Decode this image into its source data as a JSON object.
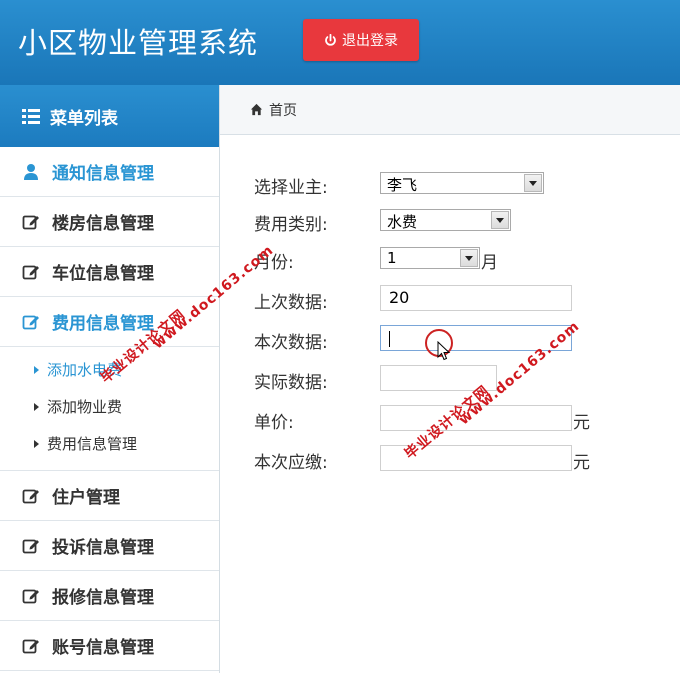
{
  "header": {
    "app_title": "小区物业管理系统",
    "logout_label": "退出登录"
  },
  "sidebar": {
    "menu_title": "菜单列表",
    "items": [
      {
        "label": "通知信息管理",
        "icon": "user-icon"
      },
      {
        "label": "楼房信息管理",
        "icon": "edit-icon"
      },
      {
        "label": "车位信息管理",
        "icon": "edit-icon"
      },
      {
        "label": "费用信息管理",
        "icon": "edit-icon"
      }
    ],
    "submenu": [
      {
        "label": "添加水电费"
      },
      {
        "label": "添加物业费"
      },
      {
        "label": "费用信息管理"
      }
    ],
    "items_after": [
      {
        "label": "住户管理",
        "icon": "edit-icon"
      },
      {
        "label": "投诉信息管理",
        "icon": "edit-icon"
      },
      {
        "label": "报修信息管理",
        "icon": "edit-icon"
      },
      {
        "label": "账号信息管理",
        "icon": "edit-icon"
      }
    ]
  },
  "breadcrumb": {
    "home_label": "首页"
  },
  "form": {
    "owner_label": "选择业主:",
    "owner_value": "李飞",
    "fee_type_label": "费用类别:",
    "fee_type_value": "水费",
    "month_label": "月份:",
    "month_value": "1",
    "month_unit": "月",
    "last_reading_label": "上次数据:",
    "last_reading_value": "20",
    "current_reading_label": "本次数据:",
    "current_reading_value": "",
    "actual_label": "实际数据:",
    "actual_value": "",
    "unit_price_label": "单价:",
    "unit_price_value": "",
    "unit_price_unit": "元",
    "amount_due_label": "本次应缴:",
    "amount_due_value": "",
    "amount_due_unit": "元"
  },
  "watermarks": [
    "毕业设计论文网",
    "www.doc163.com"
  ],
  "colors": {
    "header_blue": "#1f80c4",
    "active_blue": "#2a95d3",
    "logout_red": "#e8383d",
    "watermark_red": "#d0191f"
  }
}
